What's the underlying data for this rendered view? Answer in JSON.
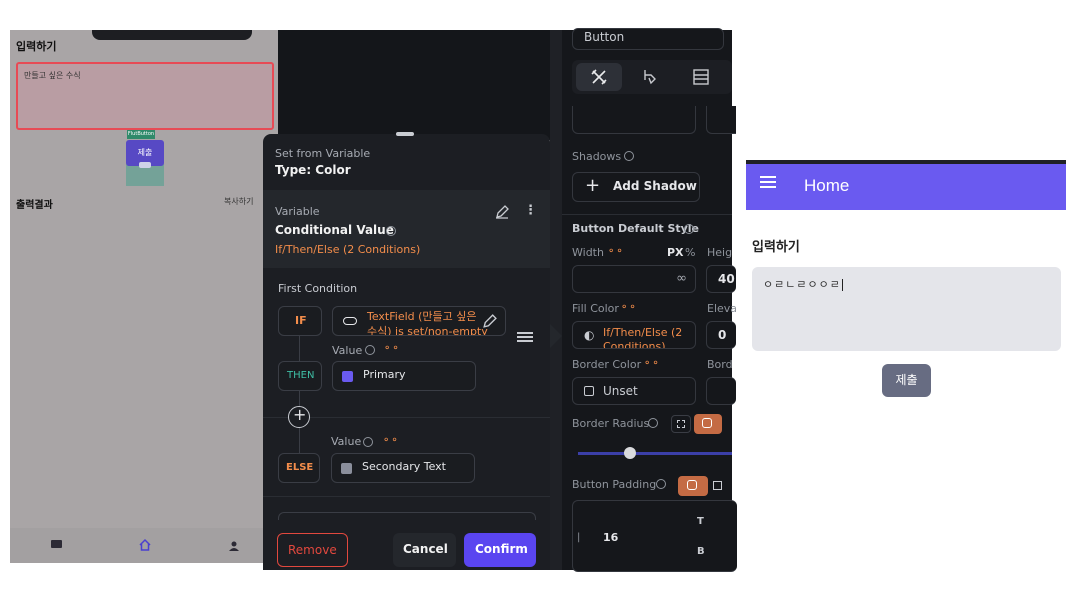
{
  "phone": {
    "input_label": "입력하기",
    "input_text": "만들고 싶은 수식",
    "button_tag": "FlutButton",
    "button_label": "제출",
    "output_label": "출력결과",
    "copy_label": "복사하기"
  },
  "modal": {
    "header_sub": "Set from Variable",
    "header_title": "Type: Color",
    "variable_label": "Variable",
    "variable_value": "Conditional Value",
    "variable_detail": "If/Then/Else (2 Conditions)",
    "first_condition": "First Condition",
    "if_label": "IF",
    "if_text_line1": "TextField (만들고 싶은",
    "if_text_line2": "수식) is set/non-empty",
    "then_label": "THEN",
    "value_label": "Value",
    "then_value": "Primary",
    "else_label": "ELSE",
    "else_value": "Secondary Text",
    "remove": "Remove",
    "cancel": "Cancel",
    "confirm": "Confirm",
    "colors": {
      "primary_swatch": "#6a5af0",
      "secondary_swatch": "#8b8f9c",
      "accent": "#5a45f0",
      "orange": "#f38d4b",
      "remove_red": "#e2483e"
    }
  },
  "panel": {
    "button_name": "Button",
    "shadows_label": "Shadows",
    "add_shadow": "Add Shadow",
    "default_style": "Button Default Style",
    "width_label": "Width",
    "px": "PX",
    "pct": "%",
    "height_label": "Heig",
    "width_value": "∞",
    "height_value": "40",
    "fill_label": "Fill Color",
    "elev_label": "Eleva",
    "fill_value_line1": "If/Then/Else (2",
    "fill_value_line2": "Conditions)",
    "elev_value": "0",
    "border_color_label": "Border Color",
    "border_label2": "Bord",
    "border_color_value": "Unset",
    "border_radius_label": "Border Radius",
    "padding_label": "Button Padding",
    "padding_value": "16",
    "side_t": "T",
    "side_b": "B"
  },
  "preview": {
    "title": "Home",
    "label": "입력하기",
    "input_text": "ㅇㄹㄴㄹㅇㅇㄹ",
    "button": "제출"
  }
}
